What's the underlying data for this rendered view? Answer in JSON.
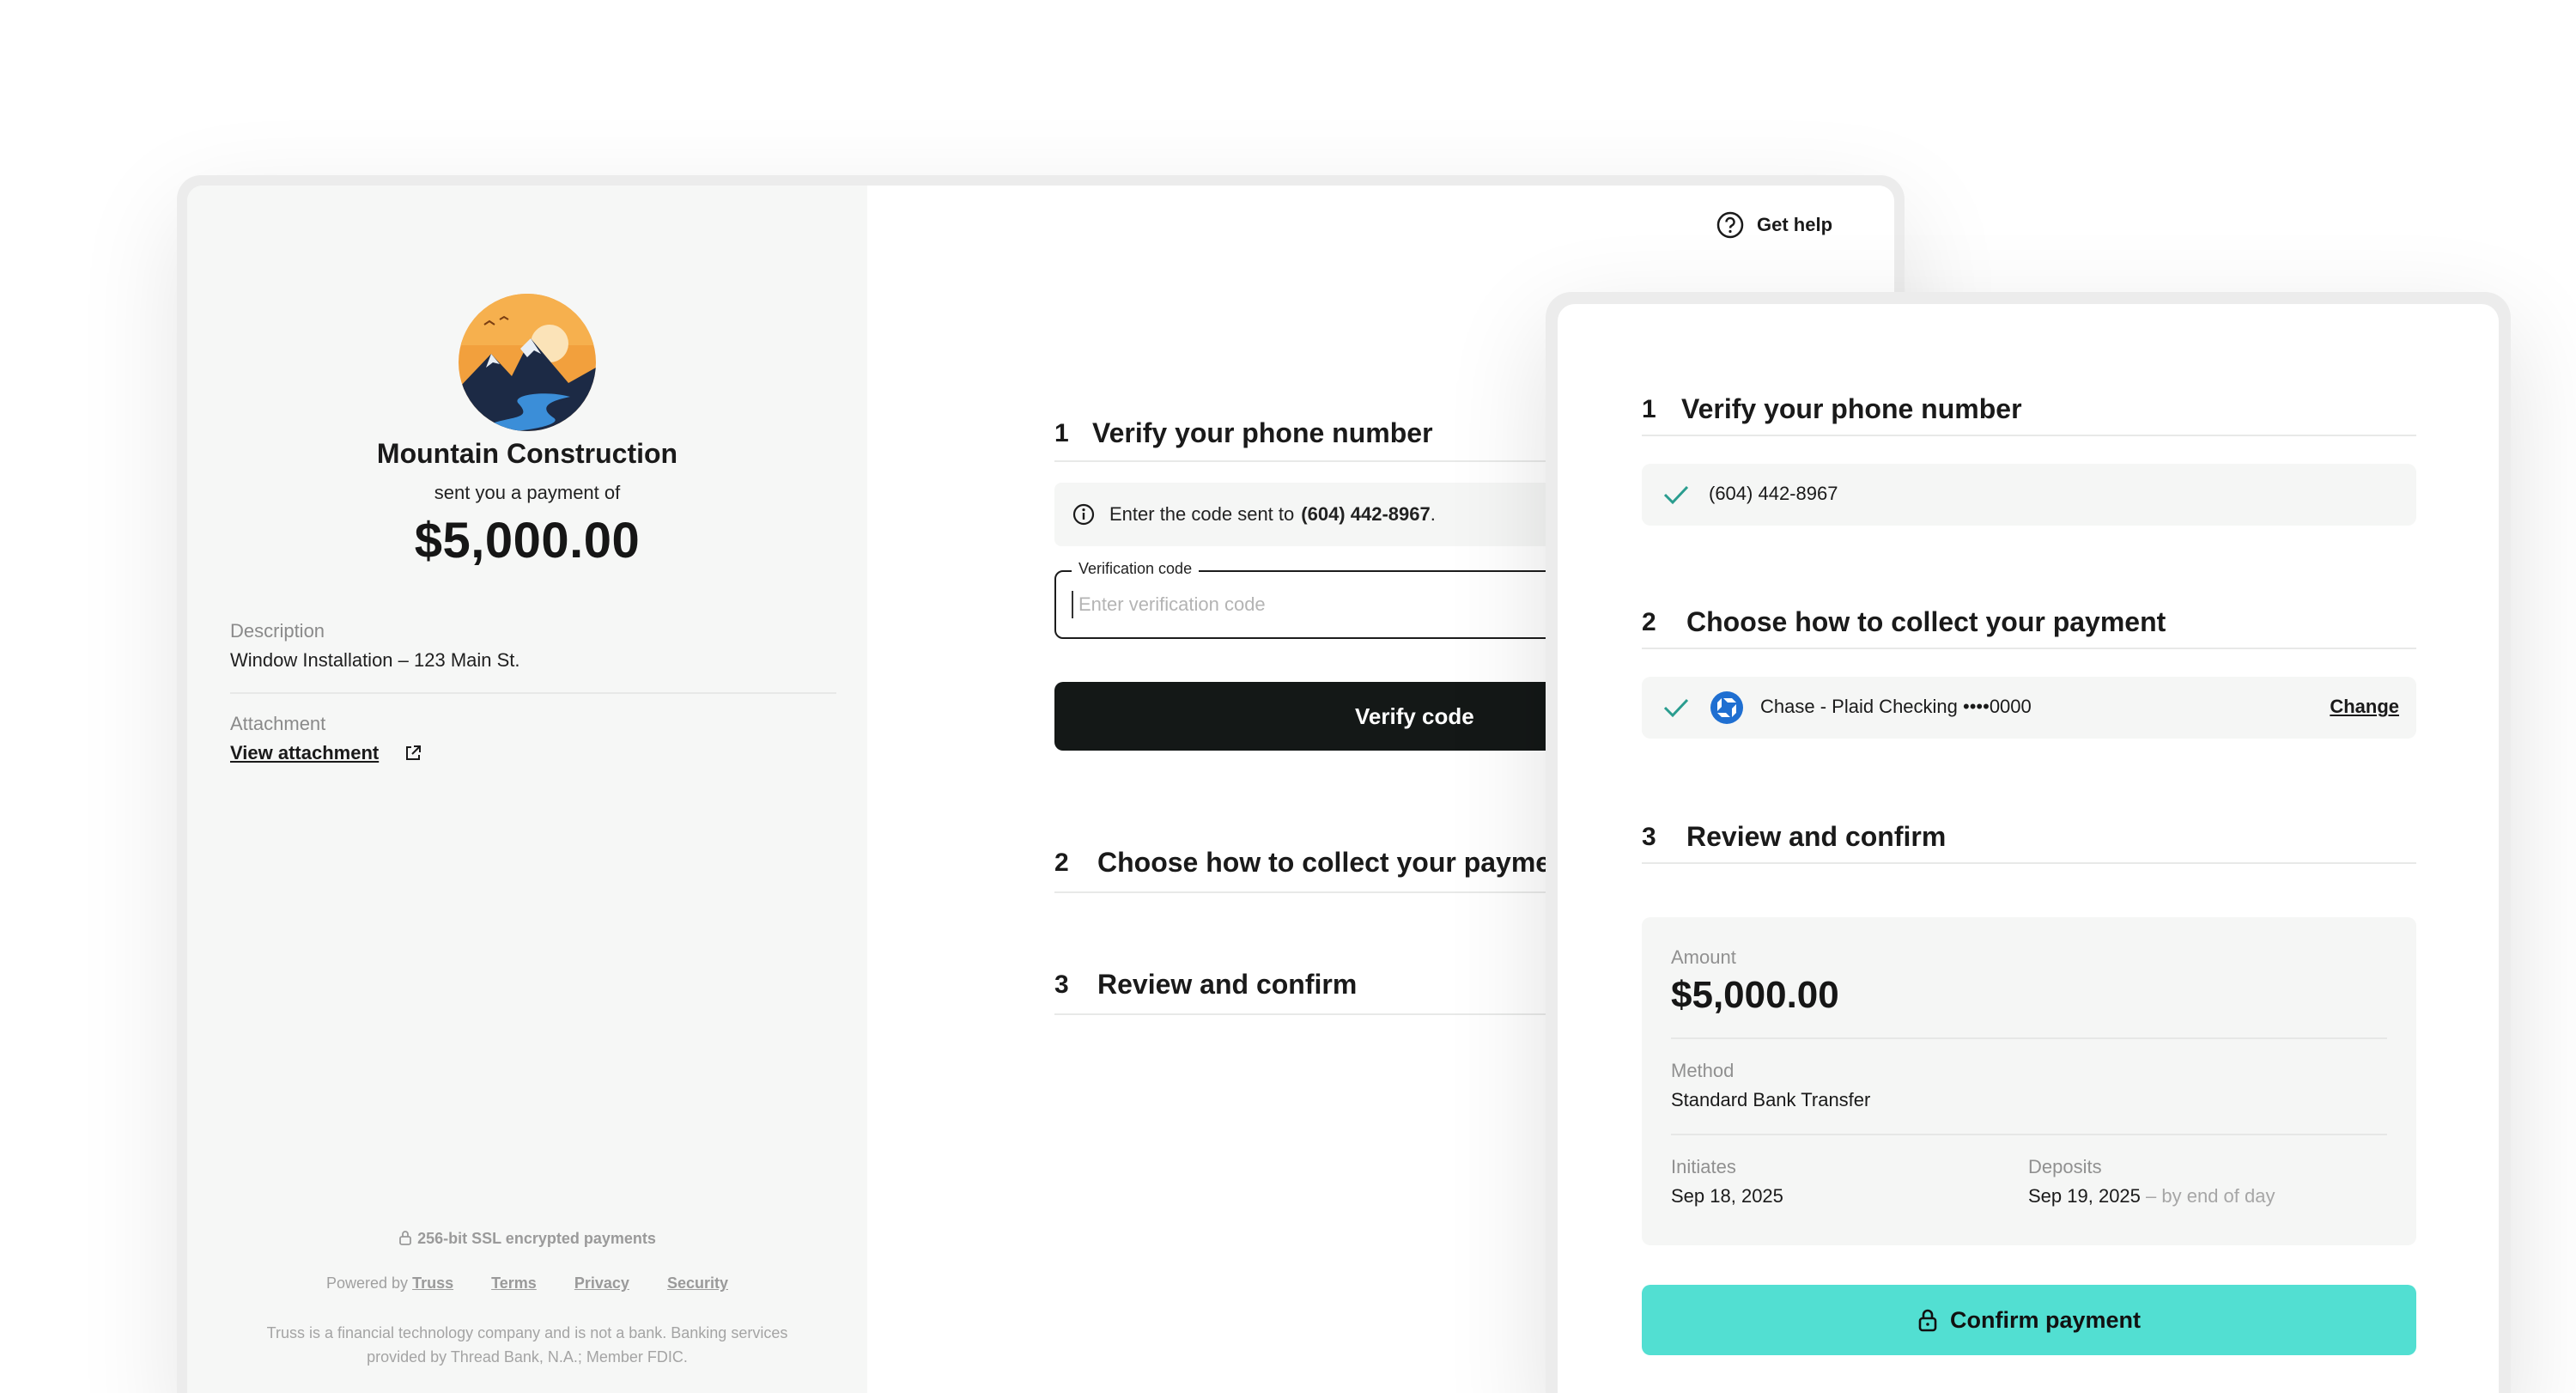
{
  "merchant": {
    "name": "Mountain Construction",
    "sent_text": "sent you a payment of",
    "amount": "$5,000.00"
  },
  "details": {
    "description_label": "Description",
    "description_value": "Window Installation – 123 Main St.",
    "attachment_label": "Attachment",
    "attachment_link": "View attachment"
  },
  "footer": {
    "ssl": "256-bit SSL encrypted payments",
    "powered_by": "Powered by",
    "brand_link": "Truss",
    "terms": "Terms",
    "privacy": "Privacy",
    "security": "Security",
    "disclaimer": "Truss is a financial technology company and is not a bank. Banking services provided by Thread Bank, N.A.; Member FDIC."
  },
  "header": {
    "help_label": "Get help"
  },
  "flow": {
    "step1": {
      "number": "1",
      "title": "Verify your phone number",
      "info_prefix": "Enter the code sent to",
      "info_phone": "(604) 442-8967",
      "info_suffix": ".",
      "field_label": "Verification code",
      "field_placeholder": "Enter verification code",
      "field_value": "",
      "button_label": "Verify code"
    },
    "step2": {
      "number": "2",
      "title": "Choose how to collect your payment"
    },
    "step3": {
      "number": "3",
      "title": "Review and confirm"
    }
  },
  "confirm_panel": {
    "step1": {
      "number": "1",
      "title": "Verify your phone number",
      "verified_phone": "(604) 442-8967"
    },
    "step2": {
      "number": "2",
      "title": "Choose how to collect your payment",
      "account_text": "Chase - Plaid Checking ••••0000",
      "change_label": "Change"
    },
    "step3": {
      "number": "3",
      "title": "Review and confirm",
      "amount_label": "Amount",
      "amount": "$5,000.00",
      "method_label": "Method",
      "method": "Standard Bank Transfer",
      "initiates_label": "Initiates",
      "initiates": "Sep 18, 2025",
      "deposits_label": "Deposits",
      "deposits": "Sep 19, 2025",
      "deposits_note": "– by end of day"
    },
    "confirm_label": "Confirm payment"
  },
  "colors": {
    "accent": "#52dfd2",
    "check": "#2a9d8f",
    "primary_button": "#141817",
    "chase_blue": "#1f6fd1"
  },
  "icons": [
    "help-circle-icon",
    "info-icon",
    "external-link-icon",
    "lock-icon",
    "check-icon",
    "chase-logo-icon",
    "mountain-logo"
  ]
}
